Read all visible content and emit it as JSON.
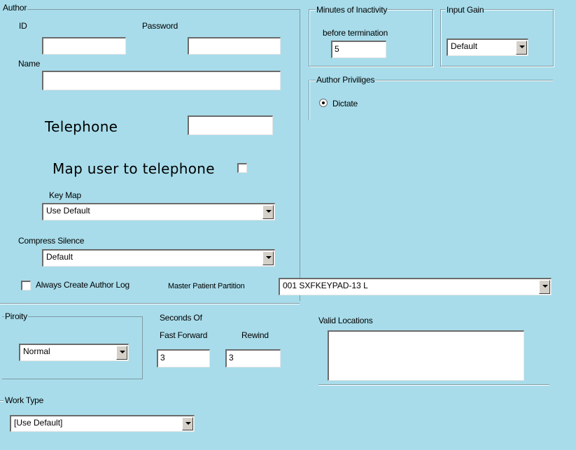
{
  "author": {
    "group_label": "Author",
    "id_label": "ID",
    "id_value": "",
    "password_label": "Password",
    "password_value": "",
    "name_label": "Name",
    "name_value": "",
    "telephone_label": "Telephone",
    "telephone_value": "",
    "map_user_label": "Map user to telephone",
    "key_map_label": "Key Map",
    "key_map_value": "Use Default",
    "compress_silence_label": "Compress Silence",
    "compress_silence_value": "Default",
    "always_create_log_label": "Always Create Author Log",
    "master_partition_label": "Master Patient Partition",
    "master_partition_value": "001  SXFKEYPAD-13 L"
  },
  "inactivity": {
    "group_label": "Minutes of Inactivity",
    "sub_label": "before termination",
    "value": "5"
  },
  "input_gain": {
    "group_label": "Input Gain",
    "value": "Default"
  },
  "privileges": {
    "group_label": "Author Priviliges",
    "dictate_label": "Dictate"
  },
  "priority": {
    "group_label": "Piroity",
    "value": "Normal"
  },
  "seconds": {
    "label": "Seconds Of",
    "fast_forward_label": "Fast Forward",
    "fast_forward_value": "3",
    "rewind_label": "Rewind",
    "rewind_value": "3"
  },
  "locations": {
    "label": "Valid Locations"
  },
  "work_type": {
    "group_label": "Work Type",
    "value": "[Use Default]"
  }
}
